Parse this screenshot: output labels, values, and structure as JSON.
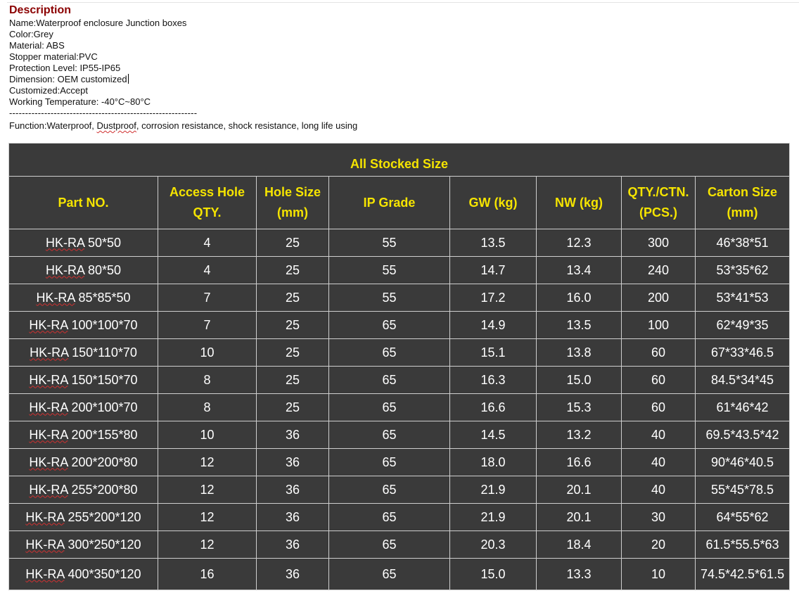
{
  "description": {
    "heading": "Description",
    "lines": [
      "Name:Waterproof enclosure Junction boxes",
      "Color:Grey",
      "Material:  ABS",
      "Stopper material:PVC",
      "Protection Level: IP55-IP65",
      "Dimension: OEM customized",
      "Customized:Accept",
      "Working Temperature: -40°C~80°C"
    ],
    "separator": "-----------------------------------------------------------",
    "function_pre": "Function:Waterproof, ",
    "function_mark": "Dustproof",
    "function_post": ", corrosion resistance, shock resistance, long life using"
  },
  "table": {
    "title": "All Stocked Size",
    "headers": [
      [
        "Part NO."
      ],
      [
        "Access Hole",
        "QTY."
      ],
      [
        "Hole Size",
        "(mm)"
      ],
      [
        "IP Grade"
      ],
      [
        "GW (kg)"
      ],
      [
        "NW (kg)"
      ],
      [
        "QTY./CTN.",
        "(PCS.)"
      ],
      [
        "Carton Size",
        "(mm)"
      ]
    ],
    "part_prefix": "HK-RA",
    "rows": [
      {
        "size": "50*50",
        "holes": "4",
        "hole_size": "25",
        "ip": "55",
        "gw": "13.5",
        "nw": "12.3",
        "qty": "300",
        "carton": "46*38*51"
      },
      {
        "size": "80*50",
        "holes": "4",
        "hole_size": "25",
        "ip": "55",
        "gw": "14.7",
        "nw": "13.4",
        "qty": "240",
        "carton": "53*35*62"
      },
      {
        "size": "85*85*50",
        "holes": "7",
        "hole_size": "25",
        "ip": "55",
        "gw": "17.2",
        "nw": "16.0",
        "qty": "200",
        "carton": "53*41*53"
      },
      {
        "size": "100*100*70",
        "holes": "7",
        "hole_size": "25",
        "ip": "65",
        "gw": "14.9",
        "nw": "13.5",
        "qty": "100",
        "carton": "62*49*35"
      },
      {
        "size": "150*110*70",
        "holes": "10",
        "hole_size": "25",
        "ip": "65",
        "gw": "15.1",
        "nw": "13.8",
        "qty": "60",
        "carton": "67*33*46.5"
      },
      {
        "size": "150*150*70",
        "holes": "8",
        "hole_size": "25",
        "ip": "65",
        "gw": "16.3",
        "nw": "15.0",
        "qty": "60",
        "carton": "84.5*34*45"
      },
      {
        "size": "200*100*70",
        "holes": "8",
        "hole_size": "25",
        "ip": "65",
        "gw": "16.6",
        "nw": "15.3",
        "qty": "60",
        "carton": "61*46*42"
      },
      {
        "size": "200*155*80",
        "holes": "10",
        "hole_size": "36",
        "ip": "65",
        "gw": "14.5",
        "nw": "13.2",
        "qty": "40",
        "carton": "69.5*43.5*42"
      },
      {
        "size": "200*200*80",
        "holes": "12",
        "hole_size": "36",
        "ip": "65",
        "gw": "18.0",
        "nw": "16.6",
        "qty": "40",
        "carton": "90*46*40.5"
      },
      {
        "size": "255*200*80",
        "holes": "12",
        "hole_size": "36",
        "ip": "65",
        "gw": "21.9",
        "nw": "20.1",
        "qty": "40",
        "carton": "55*45*78.5"
      },
      {
        "size": "255*200*120",
        "holes": "12",
        "hole_size": "36",
        "ip": "65",
        "gw": "21.9",
        "nw": "20.1",
        "qty": "30",
        "carton": "64*55*62"
      },
      {
        "size": "300*250*120",
        "holes": "12",
        "hole_size": "36",
        "ip": "65",
        "gw": "20.3",
        "nw": "18.4",
        "qty": "20",
        "carton": "61.5*55.5*63"
      },
      {
        "size": "400*350*120",
        "holes": "16",
        "hole_size": "36",
        "ip": "65",
        "gw": "15.0",
        "nw": "13.3",
        "qty": "10",
        "carton": "74.5*42.5*61.5"
      }
    ]
  }
}
